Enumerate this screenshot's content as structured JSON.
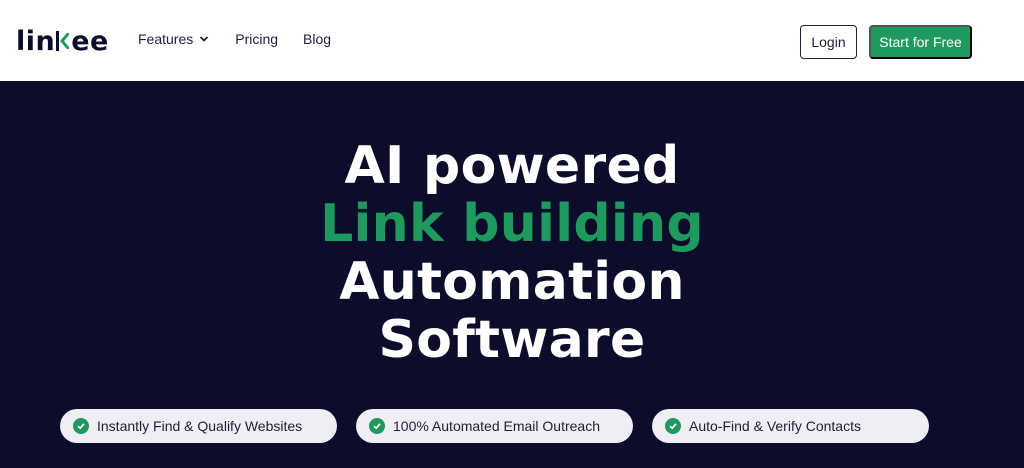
{
  "header": {
    "logo": {
      "part1": "lin",
      "part2": "ee"
    },
    "nav": {
      "features": "Features",
      "pricing": "Pricing",
      "blog": "Blog"
    },
    "login_label": "Login",
    "cta_label": "Start for Free"
  },
  "hero": {
    "line1": "AI powered",
    "line2": "Link building",
    "line3": "Automation",
    "line4": "Software",
    "pills": [
      {
        "label": "Instantly Find & Qualify Websites"
      },
      {
        "label": "100% Automated Email Outreach"
      },
      {
        "label": "Auto-Find & Verify Contacts"
      }
    ]
  },
  "colors": {
    "brand_green": "#1f9a5e",
    "navy": "#0b0d2a",
    "pill_bg": "#eeeef4"
  },
  "icons": {
    "dropdown": "chevron-down-icon",
    "pill_check": "check-circle-icon"
  }
}
